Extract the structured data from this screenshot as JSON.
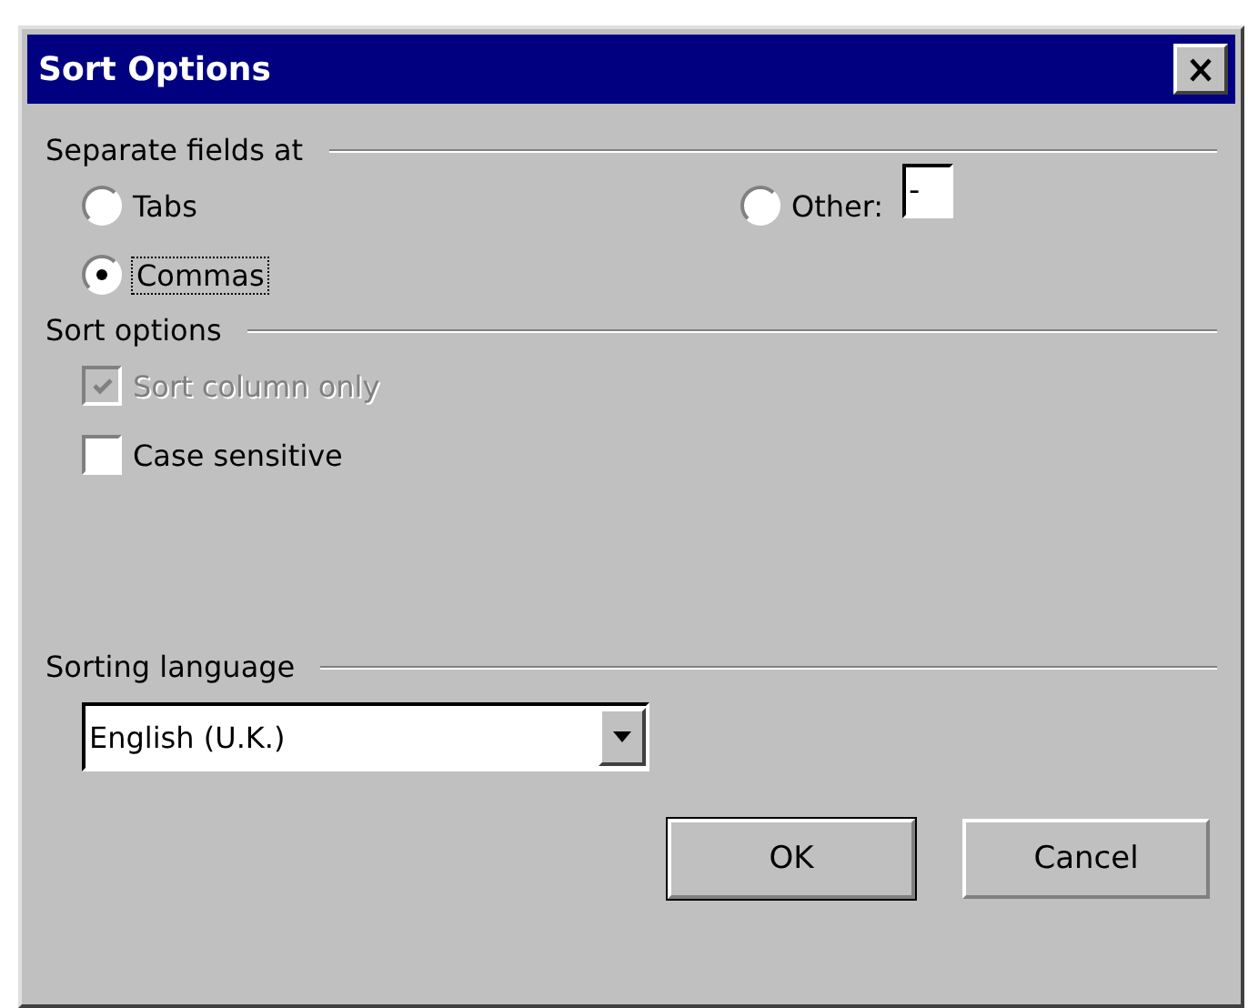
{
  "window": {
    "title": "Sort Options"
  },
  "separate_fields": {
    "heading": "Separate fields at",
    "options": [
      {
        "label": "Tabs",
        "selected": false,
        "focused": false
      },
      {
        "label": "Commas",
        "selected": true,
        "focused": true
      },
      {
        "label": "Other:",
        "selected": false,
        "focused": false
      }
    ],
    "other_value": "-"
  },
  "sort_options": {
    "heading": "Sort options",
    "checkboxes": [
      {
        "label": "Sort column only",
        "checked": true,
        "disabled": true
      },
      {
        "label": "Case sensitive",
        "checked": false,
        "disabled": false
      }
    ]
  },
  "sorting_language": {
    "heading": "Sorting language",
    "value": "English (U.K.)"
  },
  "buttons": [
    {
      "label": "OK",
      "default": true
    },
    {
      "label": "Cancel",
      "default": false
    }
  ]
}
